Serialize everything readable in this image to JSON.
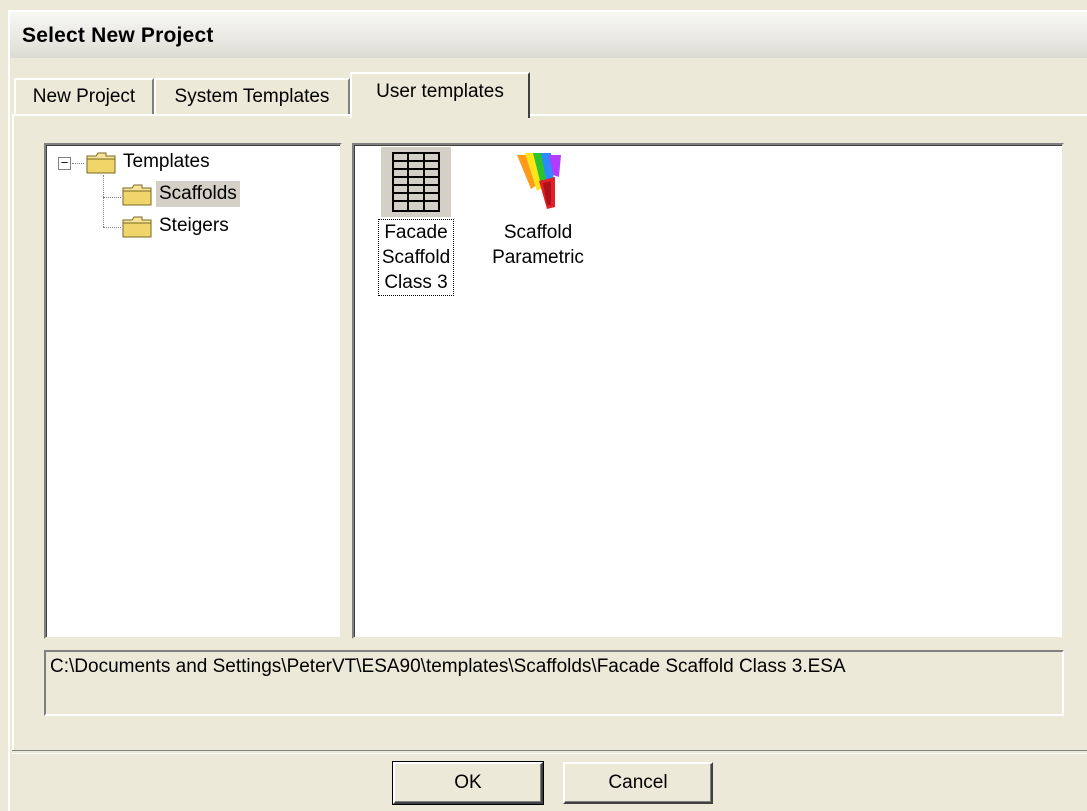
{
  "window": {
    "title": "Select New Project"
  },
  "tabs": [
    {
      "label": "New Project"
    },
    {
      "label": "System Templates"
    },
    {
      "label": "User templates",
      "active": true
    }
  ],
  "tree": {
    "root": {
      "label": "Templates",
      "expanded": true,
      "expander": "−"
    },
    "children": [
      {
        "label": "Scaffolds",
        "selected": true
      },
      {
        "label": "Steigers"
      }
    ]
  },
  "items": [
    {
      "caption_lines": [
        "Facade",
        "Scaffold",
        "Class 3"
      ],
      "icon": "grid-icon",
      "selected": true
    },
    {
      "caption_lines": [
        "Scaffold",
        "Parametric"
      ],
      "icon": "scaffold-parametric-icon"
    }
  ],
  "path": "C:\\Documents and Settings\\PeterVT\\ESA90\\templates\\Scaffolds\\Facade Scaffold Class 3.ESA",
  "buttons": {
    "ok": "OK",
    "cancel": "Cancel"
  },
  "colors": {
    "face": "#ece9d8",
    "selection": "#d4d0c8",
    "shadow": "#808080"
  }
}
